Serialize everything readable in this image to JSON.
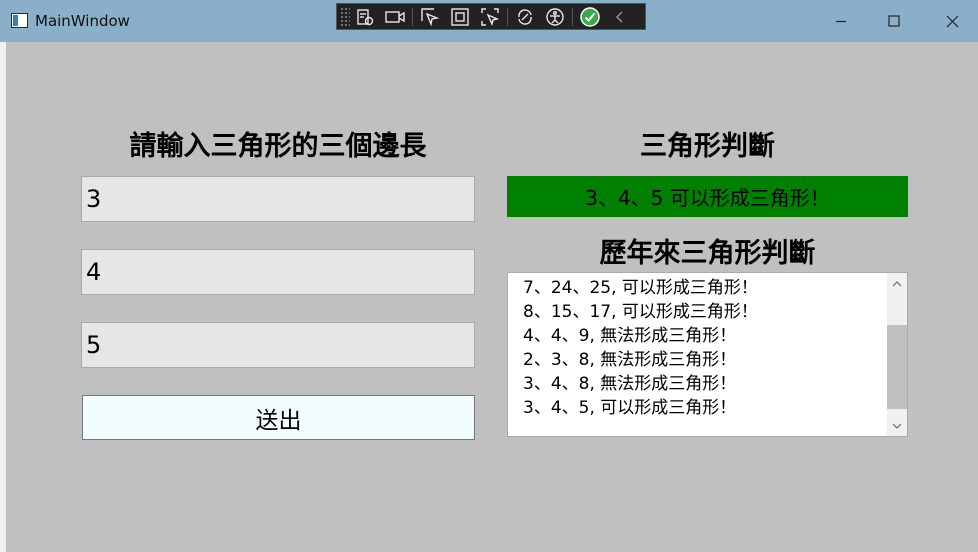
{
  "window": {
    "title": "MainWindow"
  },
  "left_panel": {
    "heading": "請輸入三角形的三個邊長",
    "inputs": [
      "3",
      "4",
      "5"
    ],
    "submit_label": "送出"
  },
  "right_panel": {
    "heading": "三角形判斷",
    "result_text": "3、4、5  可以形成三角形！",
    "result_color": "#008000",
    "history_heading": "歷年來三角形判斷",
    "history": [
      "7、24、25,  可以形成三角形！",
      "8、15、17,  可以形成三角形！",
      "4、4、9,  無法形成三角形！",
      "2、3、8,  無法形成三角形！",
      "3、4、8,  無法形成三角形！",
      "3、4、5,  可以形成三角形！"
    ]
  },
  "toolbar_icons": [
    "live-visual-tree-icon",
    "record-icon",
    "select-element-icon",
    "display-layout-adorners-icon",
    "track-focus-icon",
    "hot-reload-icon",
    "accessibility-icon",
    "binding-ok-icon",
    "collapse-chevron-icon"
  ],
  "window_controls": [
    "minimize-icon",
    "maximize-icon",
    "close-icon"
  ]
}
